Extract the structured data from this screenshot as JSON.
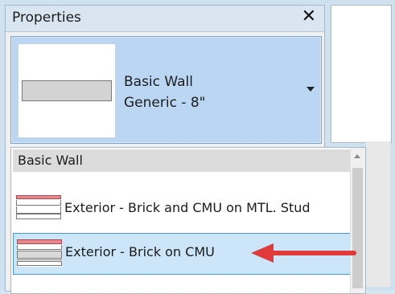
{
  "panel": {
    "title": "Properties",
    "close_icon": "close-icon",
    "close_glyph": "✕"
  },
  "type_selector": {
    "family": "Basic Wall",
    "type": "Generic - 8\"",
    "arrow_icon": "triangle-down-icon"
  },
  "dropdown": {
    "group_header": "Basic Wall",
    "items": [
      {
        "label": "Exterior - Brick and CMU on MTL. Stud",
        "selected": false
      },
      {
        "label": "Exterior - Brick on CMU",
        "selected": true
      }
    ]
  },
  "annotation": {
    "arrow_color": "#e03a3a",
    "arrow_icon": "arrow-left-icon"
  },
  "colors": {
    "selector_bg": "#bad6f2",
    "selected_item_bg": "#cde5f9",
    "selected_item_border": "#4a97d8",
    "brick_band": "#e8898e",
    "group_header_bg": "#dcdcdc"
  }
}
